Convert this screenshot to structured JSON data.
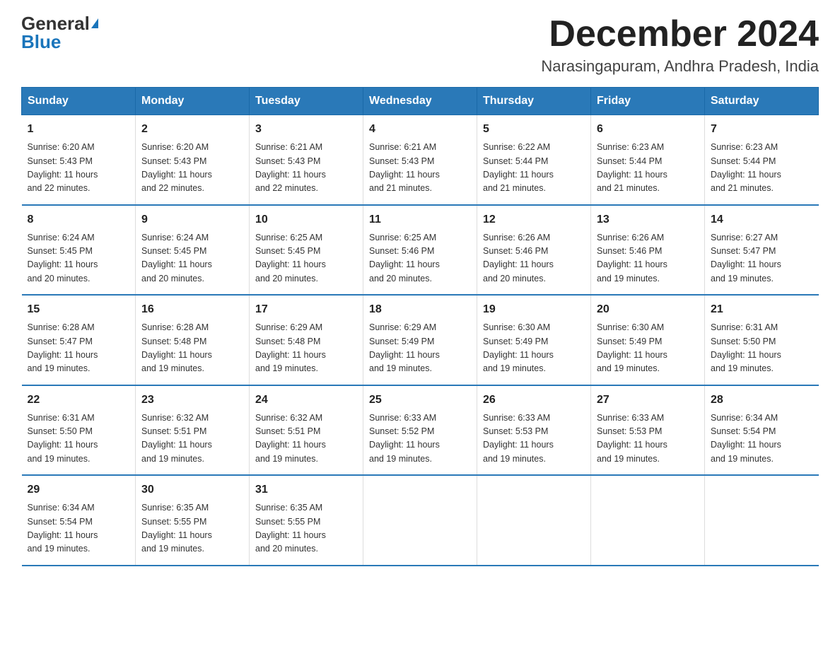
{
  "logo": {
    "general": "General",
    "blue": "Blue"
  },
  "title": "December 2024",
  "location": "Narasingapuram, Andhra Pradesh, India",
  "days_of_week": [
    "Sunday",
    "Monday",
    "Tuesday",
    "Wednesday",
    "Thursday",
    "Friday",
    "Saturday"
  ],
  "weeks": [
    [
      {
        "day": "1",
        "info": "Sunrise: 6:20 AM\nSunset: 5:43 PM\nDaylight: 11 hours\nand 22 minutes."
      },
      {
        "day": "2",
        "info": "Sunrise: 6:20 AM\nSunset: 5:43 PM\nDaylight: 11 hours\nand 22 minutes."
      },
      {
        "day": "3",
        "info": "Sunrise: 6:21 AM\nSunset: 5:43 PM\nDaylight: 11 hours\nand 22 minutes."
      },
      {
        "day": "4",
        "info": "Sunrise: 6:21 AM\nSunset: 5:43 PM\nDaylight: 11 hours\nand 21 minutes."
      },
      {
        "day": "5",
        "info": "Sunrise: 6:22 AM\nSunset: 5:44 PM\nDaylight: 11 hours\nand 21 minutes."
      },
      {
        "day": "6",
        "info": "Sunrise: 6:23 AM\nSunset: 5:44 PM\nDaylight: 11 hours\nand 21 minutes."
      },
      {
        "day": "7",
        "info": "Sunrise: 6:23 AM\nSunset: 5:44 PM\nDaylight: 11 hours\nand 21 minutes."
      }
    ],
    [
      {
        "day": "8",
        "info": "Sunrise: 6:24 AM\nSunset: 5:45 PM\nDaylight: 11 hours\nand 20 minutes."
      },
      {
        "day": "9",
        "info": "Sunrise: 6:24 AM\nSunset: 5:45 PM\nDaylight: 11 hours\nand 20 minutes."
      },
      {
        "day": "10",
        "info": "Sunrise: 6:25 AM\nSunset: 5:45 PM\nDaylight: 11 hours\nand 20 minutes."
      },
      {
        "day": "11",
        "info": "Sunrise: 6:25 AM\nSunset: 5:46 PM\nDaylight: 11 hours\nand 20 minutes."
      },
      {
        "day": "12",
        "info": "Sunrise: 6:26 AM\nSunset: 5:46 PM\nDaylight: 11 hours\nand 20 minutes."
      },
      {
        "day": "13",
        "info": "Sunrise: 6:26 AM\nSunset: 5:46 PM\nDaylight: 11 hours\nand 19 minutes."
      },
      {
        "day": "14",
        "info": "Sunrise: 6:27 AM\nSunset: 5:47 PM\nDaylight: 11 hours\nand 19 minutes."
      }
    ],
    [
      {
        "day": "15",
        "info": "Sunrise: 6:28 AM\nSunset: 5:47 PM\nDaylight: 11 hours\nand 19 minutes."
      },
      {
        "day": "16",
        "info": "Sunrise: 6:28 AM\nSunset: 5:48 PM\nDaylight: 11 hours\nand 19 minutes."
      },
      {
        "day": "17",
        "info": "Sunrise: 6:29 AM\nSunset: 5:48 PM\nDaylight: 11 hours\nand 19 minutes."
      },
      {
        "day": "18",
        "info": "Sunrise: 6:29 AM\nSunset: 5:49 PM\nDaylight: 11 hours\nand 19 minutes."
      },
      {
        "day": "19",
        "info": "Sunrise: 6:30 AM\nSunset: 5:49 PM\nDaylight: 11 hours\nand 19 minutes."
      },
      {
        "day": "20",
        "info": "Sunrise: 6:30 AM\nSunset: 5:49 PM\nDaylight: 11 hours\nand 19 minutes."
      },
      {
        "day": "21",
        "info": "Sunrise: 6:31 AM\nSunset: 5:50 PM\nDaylight: 11 hours\nand 19 minutes."
      }
    ],
    [
      {
        "day": "22",
        "info": "Sunrise: 6:31 AM\nSunset: 5:50 PM\nDaylight: 11 hours\nand 19 minutes."
      },
      {
        "day": "23",
        "info": "Sunrise: 6:32 AM\nSunset: 5:51 PM\nDaylight: 11 hours\nand 19 minutes."
      },
      {
        "day": "24",
        "info": "Sunrise: 6:32 AM\nSunset: 5:51 PM\nDaylight: 11 hours\nand 19 minutes."
      },
      {
        "day": "25",
        "info": "Sunrise: 6:33 AM\nSunset: 5:52 PM\nDaylight: 11 hours\nand 19 minutes."
      },
      {
        "day": "26",
        "info": "Sunrise: 6:33 AM\nSunset: 5:53 PM\nDaylight: 11 hours\nand 19 minutes."
      },
      {
        "day": "27",
        "info": "Sunrise: 6:33 AM\nSunset: 5:53 PM\nDaylight: 11 hours\nand 19 minutes."
      },
      {
        "day": "28",
        "info": "Sunrise: 6:34 AM\nSunset: 5:54 PM\nDaylight: 11 hours\nand 19 minutes."
      }
    ],
    [
      {
        "day": "29",
        "info": "Sunrise: 6:34 AM\nSunset: 5:54 PM\nDaylight: 11 hours\nand 19 minutes."
      },
      {
        "day": "30",
        "info": "Sunrise: 6:35 AM\nSunset: 5:55 PM\nDaylight: 11 hours\nand 19 minutes."
      },
      {
        "day": "31",
        "info": "Sunrise: 6:35 AM\nSunset: 5:55 PM\nDaylight: 11 hours\nand 20 minutes."
      },
      {
        "day": "",
        "info": ""
      },
      {
        "day": "",
        "info": ""
      },
      {
        "day": "",
        "info": ""
      },
      {
        "day": "",
        "info": ""
      }
    ]
  ]
}
